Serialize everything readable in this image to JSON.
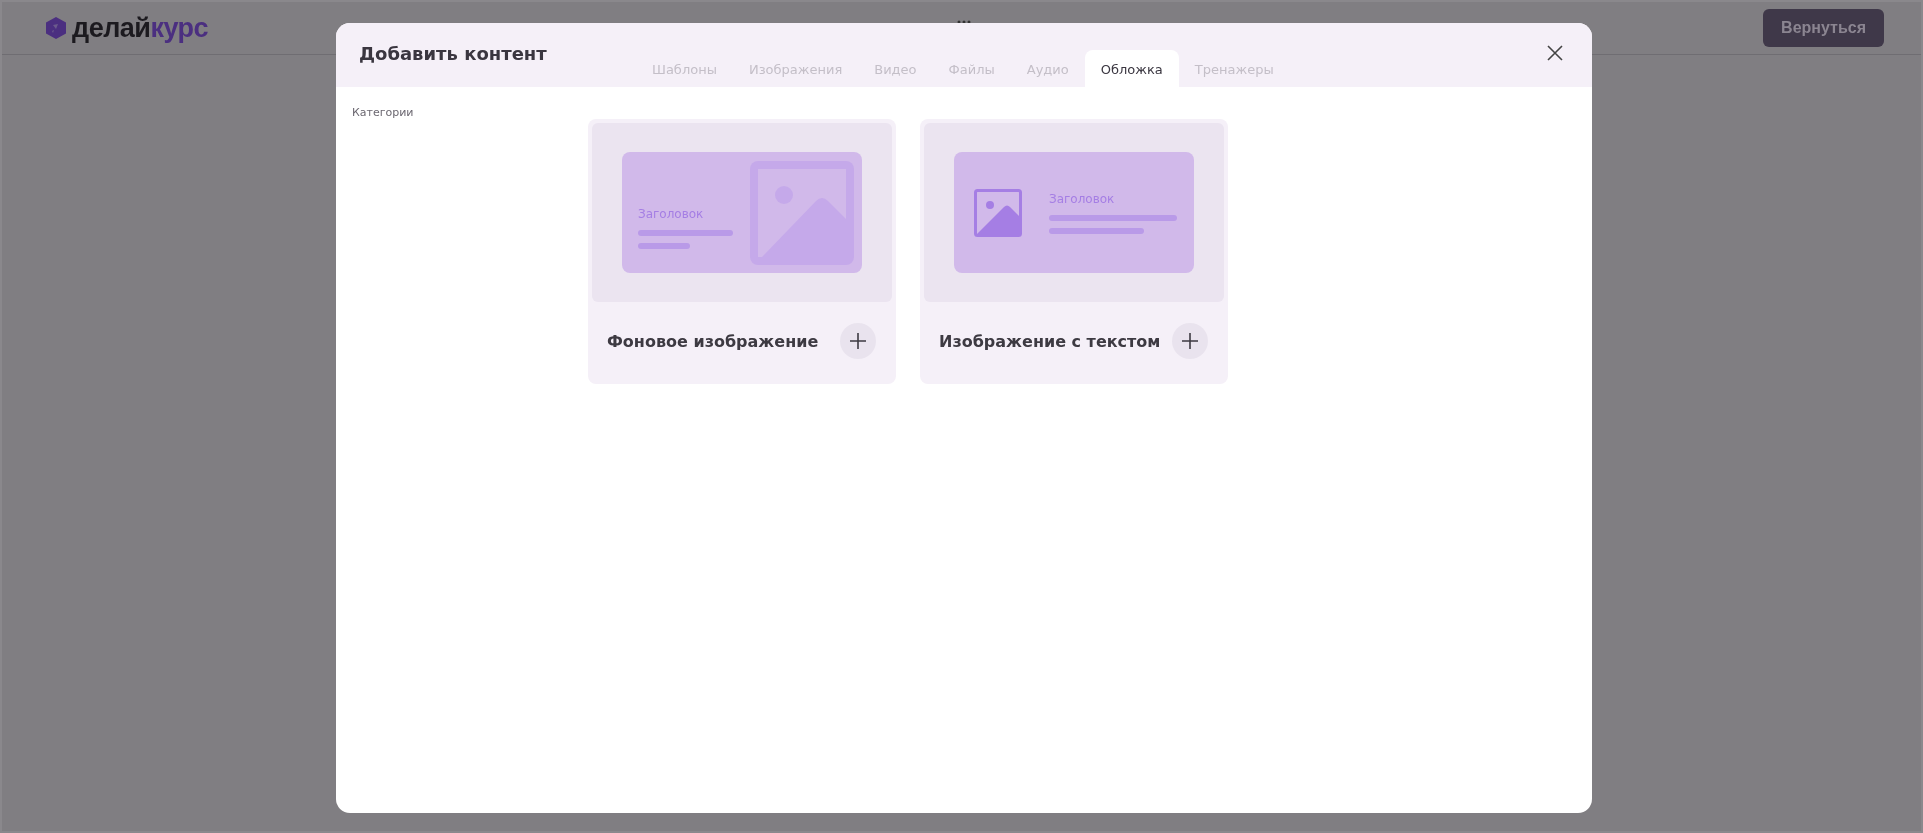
{
  "header": {
    "logo": {
      "text_dark": "делай",
      "text_accent": "курс"
    },
    "back_button": "Вернуться"
  },
  "modal": {
    "title": "Добавить контент",
    "tabs": [
      {
        "label": "Шаблоны",
        "selected": false
      },
      {
        "label": "Изображения",
        "selected": false
      },
      {
        "label": "Видео",
        "selected": false
      },
      {
        "label": "Файлы",
        "selected": false
      },
      {
        "label": "Аудио",
        "selected": false
      },
      {
        "label": "Обложка",
        "selected": true
      },
      {
        "label": "Тренажеры",
        "selected": false
      }
    ],
    "sidebar": {
      "label": "Категории"
    },
    "cards": [
      {
        "kind": "background",
        "preview_heading": "Заголовок",
        "title": "Фоновое изображение"
      },
      {
        "kind": "side",
        "preview_heading": "Заголовок",
        "title": "Изображение с текстом"
      }
    ]
  }
}
